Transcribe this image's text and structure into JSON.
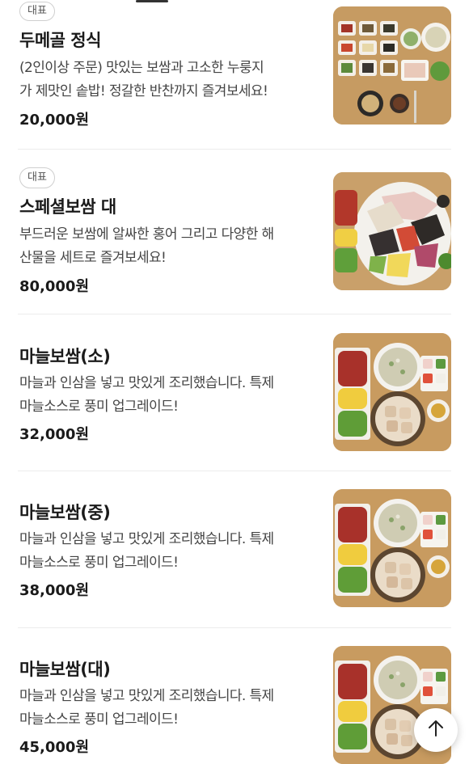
{
  "menu_items": [
    {
      "badge": "대표",
      "name": "두메골 정식",
      "desc_line1": "(2인이상 주문) 맛있는 보쌈과 고소한 누룽지",
      "desc_line2": "가 제맛인 솥밥! 정갈한 반찬까지 즐겨보세요!",
      "price": "20,000원",
      "image_icon": "set-meal-photo"
    },
    {
      "badge": "대표",
      "name": "스페셜보쌈 대",
      "desc_line1": "부드러운 보쌈에 알싸한 홍어 그리고 다양한 해",
      "desc_line2": "산물을 세트로 즐겨보세요!",
      "price": "80,000원",
      "image_icon": "special-bossam-platter-photo"
    },
    {
      "name": "마늘보쌈(소)",
      "desc_line1": "마늘과 인삼을 넣고 맛있게 조리했습니다. 특제",
      "desc_line2": "마늘소스로 풍미 업그레이드!",
      "price": "32,000원",
      "image_icon": "garlic-bossam-photo"
    },
    {
      "name": "마늘보쌈(중)",
      "desc_line1": "마늘과 인삼을 넣고 맛있게 조리했습니다. 특제",
      "desc_line2": "마늘소스로 풍미 업그레이드!",
      "price": "38,000원",
      "image_icon": "garlic-bossam-photo"
    },
    {
      "name": "마늘보쌈(대)",
      "desc_line1": "마늘과 인삼을 넣고 맛있게 조리했습니다. 특제",
      "desc_line2": "마늘소스로 풍미 업그레이드!",
      "price": "45,000원",
      "image_icon": "garlic-bossam-photo"
    }
  ],
  "scroll_top_button": {
    "icon": "arrow-up-icon"
  }
}
